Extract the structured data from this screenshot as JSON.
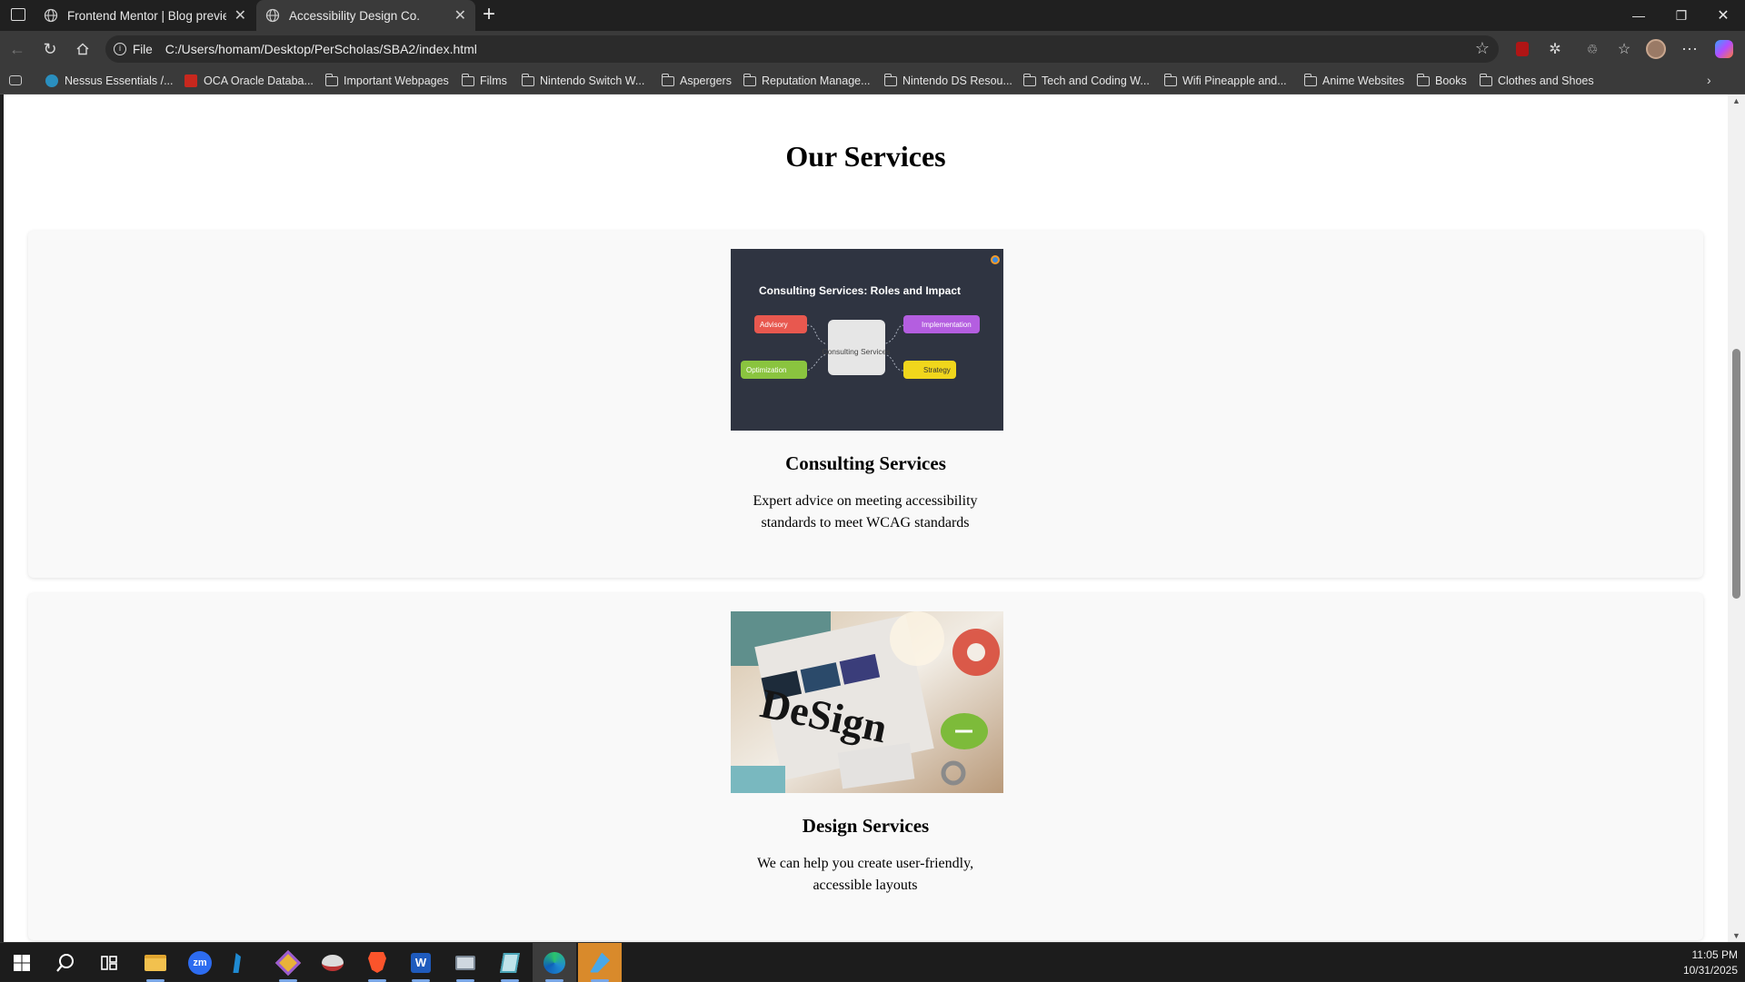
{
  "browser": {
    "tabs": [
      {
        "title": "Frontend Mentor | Blog preview c",
        "active": false
      },
      {
        "title": "Accessibility Design Co.",
        "active": true
      }
    ],
    "new_tab_label": "+",
    "address": {
      "scheme_label": "File",
      "url": "C:/Users/homam/Desktop/PerScholas/SBA2/index.html"
    },
    "bookmarks": [
      {
        "label": "Nessus Essentials /...",
        "icon": "globe-icon"
      },
      {
        "label": "OCA Oracle Databa...",
        "icon": "pdf-icon"
      },
      {
        "label": "Important Webpages",
        "icon": "folder-icon"
      },
      {
        "label": "Films",
        "icon": "folder-icon"
      },
      {
        "label": "Nintendo Switch W...",
        "icon": "folder-icon"
      },
      {
        "label": "Aspergers",
        "icon": "folder-icon"
      },
      {
        "label": "Reputation Manage...",
        "icon": "folder-icon"
      },
      {
        "label": "Nintendo DS Resou...",
        "icon": "folder-icon"
      },
      {
        "label": "Tech and Coding W...",
        "icon": "folder-icon"
      },
      {
        "label": "Wifi Pineapple and...",
        "icon": "folder-icon"
      },
      {
        "label": "Anime Websites",
        "icon": "folder-icon"
      },
      {
        "label": "Books",
        "icon": "folder-icon"
      },
      {
        "label": "Clothes and Shoes",
        "icon": "folder-icon"
      }
    ]
  },
  "page": {
    "heading": "Our Services",
    "services": [
      {
        "title": "Consulting Services",
        "description": "Expert advice on meeting accessibility standards to meet WCAG standards",
        "image": {
          "title": "Consulting Services: Roles and Impact",
          "center": "Consulting Services",
          "nodes": [
            "Advisory",
            "Implementation",
            "Optimization",
            "Strategy"
          ]
        }
      },
      {
        "title": "Design Services",
        "description": "We can help you create user-friendly, accessible layouts",
        "image": {
          "text": "DeSign"
        }
      }
    ]
  },
  "taskbar": {
    "time": "11:05 PM",
    "date": "10/31/2025"
  },
  "colors": {
    "advisory": "#e8584f",
    "implementation": "#b45ee0",
    "optimization": "#8ac43f",
    "strategy": "#f0d61c",
    "diagram_bg": "#2f3441"
  }
}
